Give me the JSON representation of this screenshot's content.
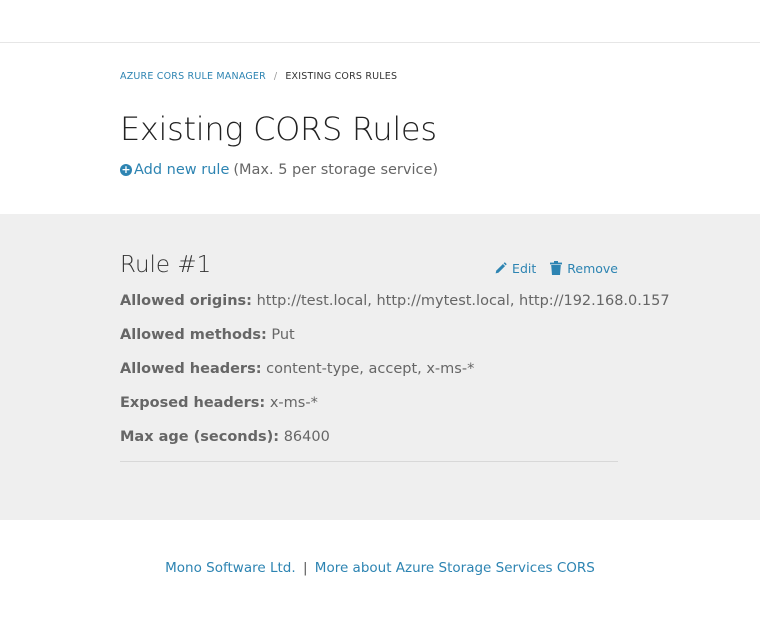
{
  "breadcrumb": {
    "parent": "AZURE CORS RULE MANAGER",
    "separator": "/",
    "current": "EXISTING CORS RULES"
  },
  "page": {
    "title": "Existing CORS Rules",
    "add_link": "Add new rule",
    "add_note": "(Max. 5 per storage service)"
  },
  "rules": [
    {
      "title": "Rule #1",
      "edit_label": "Edit",
      "remove_label": "Remove",
      "props": [
        {
          "key": "Allowed origins:",
          "value": "http://test.local, http://mytest.local, http://192.168.0.157"
        },
        {
          "key": "Allowed methods:",
          "value": "Put"
        },
        {
          "key": "Allowed headers:",
          "value": "content-type, accept, x-ms-*"
        },
        {
          "key": "Exposed headers:",
          "value": "x-ms-*"
        },
        {
          "key": "Max age (seconds):",
          "value": "86400"
        }
      ]
    }
  ],
  "footer": {
    "company": "Mono Software Ltd.",
    "separator": "|",
    "more_link": "More about Azure Storage Services CORS"
  },
  "colors": {
    "accent": "#2d84b2",
    "panel_bg": "#efefef",
    "text_muted": "#666666"
  },
  "icons": {
    "add": "plus-circle-icon",
    "edit": "pencil-icon",
    "remove": "trash-icon"
  }
}
